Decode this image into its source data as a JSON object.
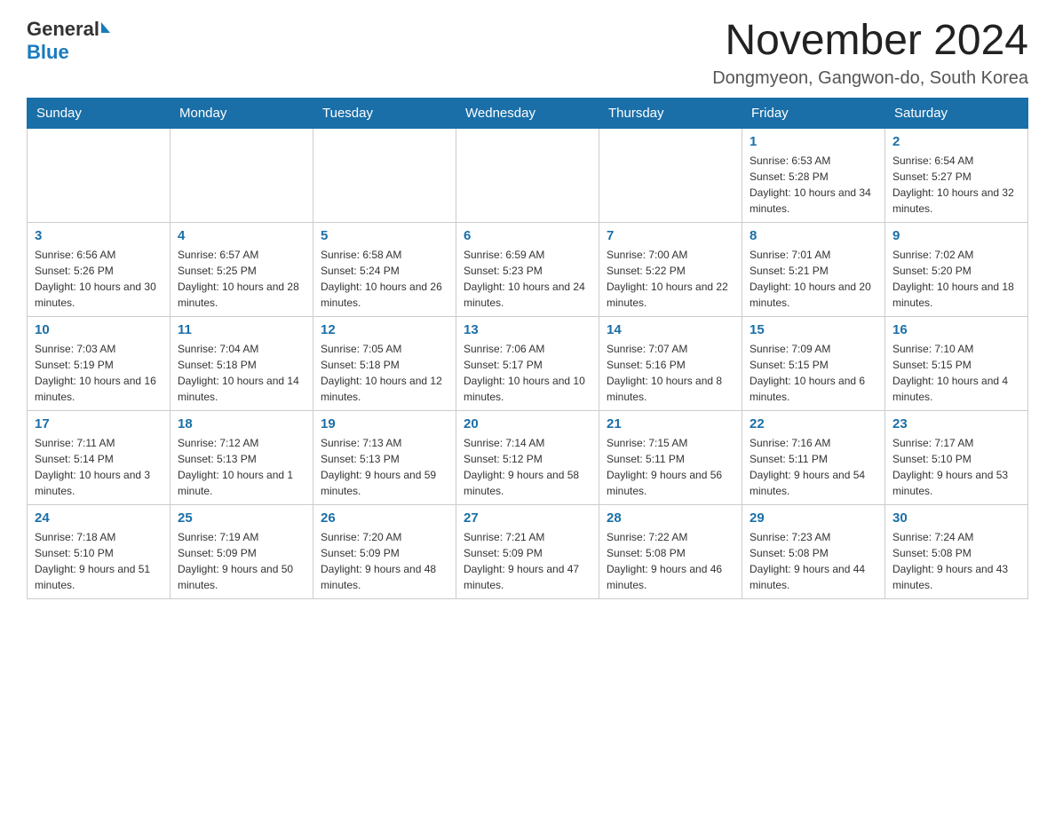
{
  "logo": {
    "general": "General",
    "blue": "Blue"
  },
  "header": {
    "month": "November 2024",
    "location": "Dongmyeon, Gangwon-do, South Korea"
  },
  "weekdays": [
    "Sunday",
    "Monday",
    "Tuesday",
    "Wednesday",
    "Thursday",
    "Friday",
    "Saturday"
  ],
  "weeks": [
    [
      {
        "day": "",
        "info": ""
      },
      {
        "day": "",
        "info": ""
      },
      {
        "day": "",
        "info": ""
      },
      {
        "day": "",
        "info": ""
      },
      {
        "day": "",
        "info": ""
      },
      {
        "day": "1",
        "info": "Sunrise: 6:53 AM\nSunset: 5:28 PM\nDaylight: 10 hours and 34 minutes."
      },
      {
        "day": "2",
        "info": "Sunrise: 6:54 AM\nSunset: 5:27 PM\nDaylight: 10 hours and 32 minutes."
      }
    ],
    [
      {
        "day": "3",
        "info": "Sunrise: 6:56 AM\nSunset: 5:26 PM\nDaylight: 10 hours and 30 minutes."
      },
      {
        "day": "4",
        "info": "Sunrise: 6:57 AM\nSunset: 5:25 PM\nDaylight: 10 hours and 28 minutes."
      },
      {
        "day": "5",
        "info": "Sunrise: 6:58 AM\nSunset: 5:24 PM\nDaylight: 10 hours and 26 minutes."
      },
      {
        "day": "6",
        "info": "Sunrise: 6:59 AM\nSunset: 5:23 PM\nDaylight: 10 hours and 24 minutes."
      },
      {
        "day": "7",
        "info": "Sunrise: 7:00 AM\nSunset: 5:22 PM\nDaylight: 10 hours and 22 minutes."
      },
      {
        "day": "8",
        "info": "Sunrise: 7:01 AM\nSunset: 5:21 PM\nDaylight: 10 hours and 20 minutes."
      },
      {
        "day": "9",
        "info": "Sunrise: 7:02 AM\nSunset: 5:20 PM\nDaylight: 10 hours and 18 minutes."
      }
    ],
    [
      {
        "day": "10",
        "info": "Sunrise: 7:03 AM\nSunset: 5:19 PM\nDaylight: 10 hours and 16 minutes."
      },
      {
        "day": "11",
        "info": "Sunrise: 7:04 AM\nSunset: 5:18 PM\nDaylight: 10 hours and 14 minutes."
      },
      {
        "day": "12",
        "info": "Sunrise: 7:05 AM\nSunset: 5:18 PM\nDaylight: 10 hours and 12 minutes."
      },
      {
        "day": "13",
        "info": "Sunrise: 7:06 AM\nSunset: 5:17 PM\nDaylight: 10 hours and 10 minutes."
      },
      {
        "day": "14",
        "info": "Sunrise: 7:07 AM\nSunset: 5:16 PM\nDaylight: 10 hours and 8 minutes."
      },
      {
        "day": "15",
        "info": "Sunrise: 7:09 AM\nSunset: 5:15 PM\nDaylight: 10 hours and 6 minutes."
      },
      {
        "day": "16",
        "info": "Sunrise: 7:10 AM\nSunset: 5:15 PM\nDaylight: 10 hours and 4 minutes."
      }
    ],
    [
      {
        "day": "17",
        "info": "Sunrise: 7:11 AM\nSunset: 5:14 PM\nDaylight: 10 hours and 3 minutes."
      },
      {
        "day": "18",
        "info": "Sunrise: 7:12 AM\nSunset: 5:13 PM\nDaylight: 10 hours and 1 minute."
      },
      {
        "day": "19",
        "info": "Sunrise: 7:13 AM\nSunset: 5:13 PM\nDaylight: 9 hours and 59 minutes."
      },
      {
        "day": "20",
        "info": "Sunrise: 7:14 AM\nSunset: 5:12 PM\nDaylight: 9 hours and 58 minutes."
      },
      {
        "day": "21",
        "info": "Sunrise: 7:15 AM\nSunset: 5:11 PM\nDaylight: 9 hours and 56 minutes."
      },
      {
        "day": "22",
        "info": "Sunrise: 7:16 AM\nSunset: 5:11 PM\nDaylight: 9 hours and 54 minutes."
      },
      {
        "day": "23",
        "info": "Sunrise: 7:17 AM\nSunset: 5:10 PM\nDaylight: 9 hours and 53 minutes."
      }
    ],
    [
      {
        "day": "24",
        "info": "Sunrise: 7:18 AM\nSunset: 5:10 PM\nDaylight: 9 hours and 51 minutes."
      },
      {
        "day": "25",
        "info": "Sunrise: 7:19 AM\nSunset: 5:09 PM\nDaylight: 9 hours and 50 minutes."
      },
      {
        "day": "26",
        "info": "Sunrise: 7:20 AM\nSunset: 5:09 PM\nDaylight: 9 hours and 48 minutes."
      },
      {
        "day": "27",
        "info": "Sunrise: 7:21 AM\nSunset: 5:09 PM\nDaylight: 9 hours and 47 minutes."
      },
      {
        "day": "28",
        "info": "Sunrise: 7:22 AM\nSunset: 5:08 PM\nDaylight: 9 hours and 46 minutes."
      },
      {
        "day": "29",
        "info": "Sunrise: 7:23 AM\nSunset: 5:08 PM\nDaylight: 9 hours and 44 minutes."
      },
      {
        "day": "30",
        "info": "Sunrise: 7:24 AM\nSunset: 5:08 PM\nDaylight: 9 hours and 43 minutes."
      }
    ]
  ]
}
